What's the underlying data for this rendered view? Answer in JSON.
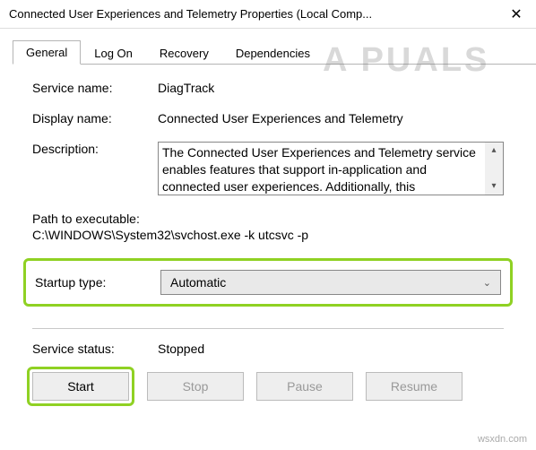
{
  "window": {
    "title": "Connected User Experiences and Telemetry Properties (Local Comp..."
  },
  "tabs": {
    "general": "General",
    "logon": "Log On",
    "recovery": "Recovery",
    "dependencies": "Dependencies"
  },
  "fields": {
    "service_name_label": "Service name:",
    "service_name_value": "DiagTrack",
    "display_name_label": "Display name:",
    "display_name_value": "Connected User Experiences and Telemetry",
    "description_label": "Description:",
    "description_value": "The Connected User Experiences and Telemetry service enables features that support in-application and connected user experiences. Additionally, this",
    "path_label": "Path to executable:",
    "path_value": "C:\\WINDOWS\\System32\\svchost.exe -k utcsvc -p",
    "startup_type_label": "Startup type:",
    "startup_type_value": "Automatic",
    "service_status_label": "Service status:",
    "service_status_value": "Stopped"
  },
  "buttons": {
    "start": "Start",
    "stop": "Stop",
    "pause": "Pause",
    "resume": "Resume"
  },
  "watermark": "A  PUALS",
  "footer": "wsxdn.com"
}
